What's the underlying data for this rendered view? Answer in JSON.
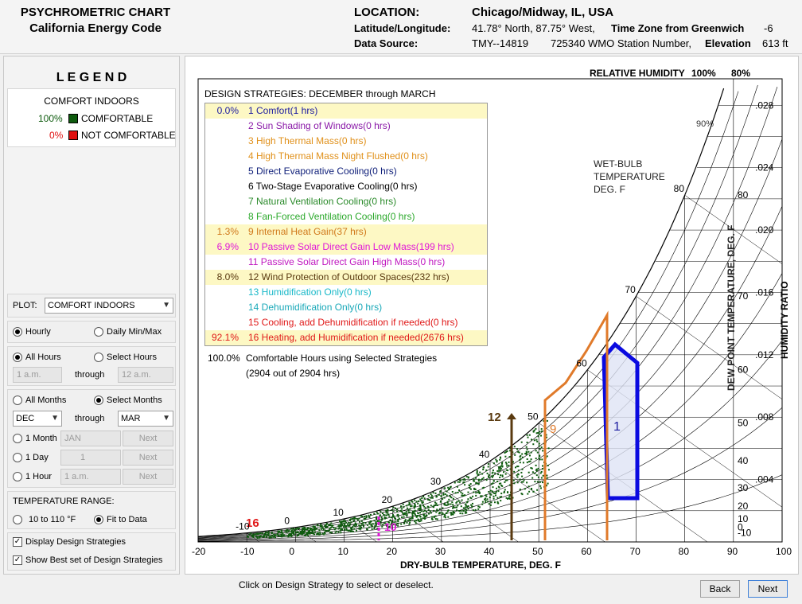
{
  "header": {
    "title_line1": "PSYCHROMETRIC CHART",
    "title_line2": "California Energy Code",
    "location_label": "LOCATION:",
    "location_value": "Chicago/Midway, IL, USA",
    "latlong_label": "Latitude/Longitude:",
    "latlong_value": "41.78° North, 87.75° West,",
    "timezone_label": "Time Zone from Greenwich",
    "timezone_value": "-6",
    "source_label": "Data Source:",
    "source_value": "TMY--14819",
    "wmo_value": "725340 WMO Station Number,",
    "elevation_label": "Elevation",
    "elevation_value": "613 ft"
  },
  "legend": {
    "title": "L E G E N D",
    "subtitle": "COMFORT INDOORS",
    "items": [
      {
        "pct": "100%",
        "label": "COMFORTABLE",
        "color": "#0e5b0e"
      },
      {
        "pct": "0%",
        "label": "NOT COMFORTABLE",
        "color": "#e01010"
      }
    ]
  },
  "controls": {
    "plot_label": "PLOT:",
    "plot_value": "COMFORT INDOORS",
    "hourly": "Hourly",
    "daily": "Daily Min/Max",
    "all_hours": "All Hours",
    "select_hours": "Select Hours",
    "hour_from": "1 a.m.",
    "through": "through",
    "hour_to": "12 a.m.",
    "all_months": "All Months",
    "select_months": "Select Months",
    "month_from": "DEC",
    "month_to": "MAR",
    "one_month": "1 Month",
    "one_month_value": "JAN",
    "one_day": "1 Day",
    "one_day_value": "1",
    "one_hour": "1 Hour",
    "one_hour_value": "1 a.m.",
    "next": "Next",
    "temp_range_label": "TEMPERATURE RANGE:",
    "temp_range_1": "10 to 110 °F",
    "temp_range_2": "Fit to Data",
    "display_strategies": "Display Design Strategies",
    "best_strategies": "Show Best set of Design Strategies"
  },
  "strategies": {
    "title": "DESIGN STRATEGIES:  DECEMBER through MARCH",
    "items": [
      {
        "pct": "0.0%",
        "label": "1  Comfort(1 hrs)",
        "color": "#1a1aa0",
        "highlight": true
      },
      {
        "pct": "",
        "label": "2  Sun Shading of Windows(0 hrs)",
        "color": "#8a1aa8",
        "highlight": false
      },
      {
        "pct": "",
        "label": "3  High Thermal Mass(0 hrs)",
        "color": "#e0901a",
        "highlight": false
      },
      {
        "pct": "",
        "label": "4  High Thermal Mass Night Flushed(0 hrs)",
        "color": "#e0901a",
        "highlight": false
      },
      {
        "pct": "",
        "label": "5  Direct Evaporative Cooling(0 hrs)",
        "color": "#10207a",
        "highlight": false
      },
      {
        "pct": "",
        "label": "6  Two-Stage Evaporative Cooling(0 hrs)",
        "color": "#000000",
        "highlight": false
      },
      {
        "pct": "",
        "label": "7  Natural Ventilation Cooling(0 hrs)",
        "color": "#2a8a2a",
        "highlight": false
      },
      {
        "pct": "",
        "label": "8  Fan-Forced Ventilation Cooling(0 hrs)",
        "color": "#2aa82a",
        "highlight": false
      },
      {
        "pct": "1.3%",
        "label": "9  Internal Heat Gain(37 hrs)",
        "color": "#d0781a",
        "highlight": true
      },
      {
        "pct": "6.9%",
        "label": "10  Passive Solar Direct Gain Low Mass(199 hrs)",
        "color": "#e018d8",
        "highlight": true
      },
      {
        "pct": "",
        "label": "11  Passive Solar Direct Gain High Mass(0 hrs)",
        "color": "#c018c0",
        "highlight": false
      },
      {
        "pct": "8.0%",
        "label": "12  Wind Protection of Outdoor Spaces(232 hrs)",
        "color": "#5a3a10",
        "highlight": true
      },
      {
        "pct": "",
        "label": "13  Humidification Only(0 hrs)",
        "color": "#18b8c8",
        "highlight": false
      },
      {
        "pct": "",
        "label": "14  Dehumidification Only(0 hrs)",
        "color": "#18a8b8",
        "highlight": false
      },
      {
        "pct": "",
        "label": "15  Cooling, add Dehumidification if needed(0 hrs)",
        "color": "#e01818",
        "highlight": false
      },
      {
        "pct": "92.1%",
        "label": "16  Heating, add Humidification if needed(2676 hrs)",
        "color": "#e01818",
        "highlight": true
      }
    ],
    "summary_pct": "100.0%",
    "summary_label": "Comfortable Hours using Selected Strategies",
    "summary_detail": "(2904 out of 2904 hrs)"
  },
  "chart": {
    "rh_title": "RELATIVE HUMIDITY",
    "rh_100": "100%",
    "rh_80": "80%",
    "rh_90": "90%",
    "wb_title1": "WET-BULB",
    "wb_title2": "TEMPERATURE",
    "wb_title3": "DEG. F",
    "xlabel": "DRY-BULB TEMPERATURE, DEG. F",
    "dewpoint_label": "DEW POINT TEMPERATURE, DEG. F",
    "hr_label": "HUMIDITY RATIO",
    "x_ticks": [
      "-20",
      "-10",
      "0",
      "10",
      "20",
      "30",
      "40",
      "50",
      "60",
      "70",
      "80",
      "90",
      "100"
    ],
    "hr_ticks": [
      ".028",
      ".024",
      ".020",
      ".016",
      ".012",
      ".008",
      ".004"
    ],
    "dp_ticks": [
      "80",
      "70",
      "60",
      "50",
      "40",
      "30",
      "20",
      "10",
      "0",
      "-10"
    ],
    "wb_ticks": [
      "-10",
      "0",
      "10",
      "20",
      "30",
      "40",
      "50",
      "60",
      "70",
      "80"
    ],
    "zone_labels": {
      "z1": "1",
      "z9": "9",
      "z12": "12",
      "z16": "16",
      "z10": "10"
    }
  },
  "chart_data": {
    "type": "scatter",
    "title": "",
    "xlabel": "DRY-BULB TEMPERATURE, DEG. F",
    "ylabel": "HUMIDITY RATIO",
    "xlim": [
      -20,
      100
    ],
    "ylim": [
      0,
      0.03
    ]
  },
  "footer": {
    "hint": "Click on Design Strategy to select or deselect.",
    "back": "Back",
    "next": "Next"
  }
}
